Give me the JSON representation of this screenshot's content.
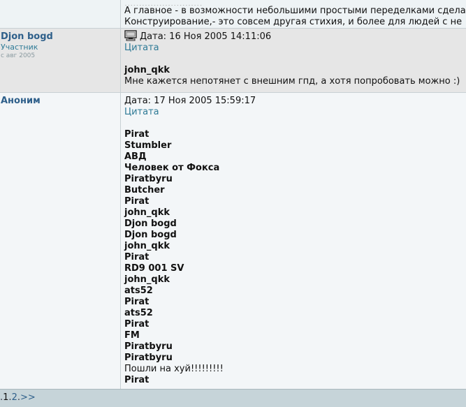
{
  "top_post": {
    "line_cut": "...........................",
    "line1": "А главное - в возможности небольшими простыми переделками сделат",
    "line2": "Конструирование,- это совсем другая стихия, и более для людей с не"
  },
  "post2": {
    "author": "Djon bogd",
    "role": "Участник",
    "since": "с авг 2005",
    "date": "Дата: 16 Ноя 2005 14:11:06",
    "quote_label": "Цитата",
    "quote_author": "john_qkk",
    "text": "Мне кажется непотянет с внешним гпд, а хотя попробовать можно :)"
  },
  "post3": {
    "author": "Аноним",
    "date": "Дата: 17 Ноя 2005 15:59:17",
    "quote_label": "Цитата",
    "names": [
      "Pirat",
      "Stumbler",
      "АВД",
      "Человек от Фокса",
      "Piratbyru",
      "Butcher",
      "Pirat",
      "john_qkk",
      "Djon bogd",
      "Djon bogd",
      "john_qkk",
      "Pirat",
      "RD9 001 SV",
      "john_qkk",
      "ats52",
      "Pirat",
      "ats52",
      "Pirat",
      "FM",
      "Piratbyru",
      "Piratbyru"
    ],
    "normal_line": "Пошли на хуй!!!!!!!!!",
    "last_name": "Pirat"
  },
  "pager": {
    "dot1": ".",
    "current": "1",
    "dot2": ".",
    "next": "2",
    "dot3": ".",
    "more": ">>"
  }
}
